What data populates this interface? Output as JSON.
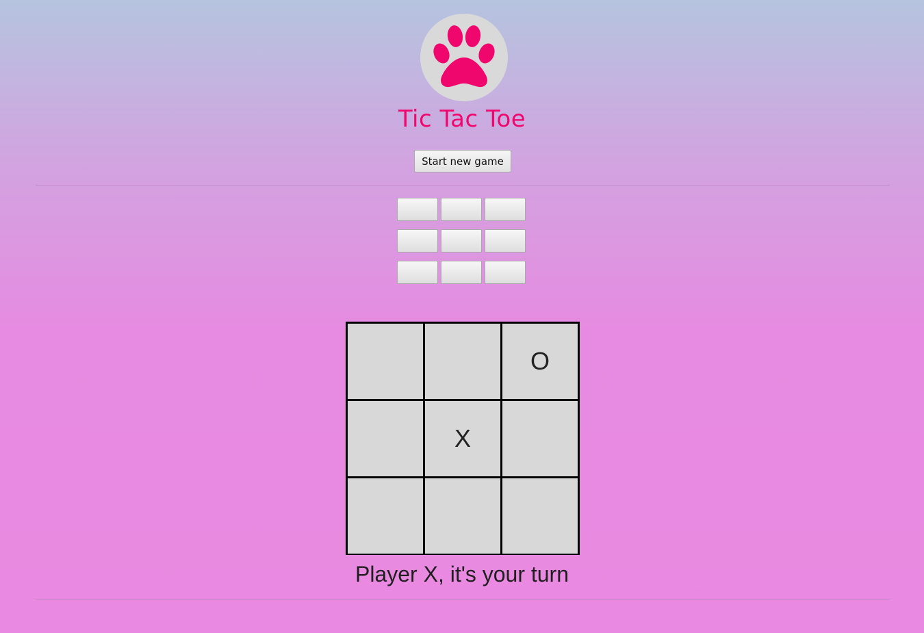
{
  "header": {
    "logo_icon": "paw-print-icon",
    "title": "Tic Tac Toe",
    "new_game_label": "Start new game"
  },
  "mini_buttons": [
    "",
    "",
    "",
    "",
    "",
    "",
    "",
    "",
    ""
  ],
  "board": {
    "cells": [
      "",
      "",
      "O",
      "",
      "X",
      "",
      "",
      "",
      ""
    ]
  },
  "status": "Player X, it's your turn",
  "colors": {
    "accent": "#f0076e",
    "logo_bg": "#d9d9d9",
    "cell_bg": "#d8d8d8",
    "grid_line": "#000000",
    "gradient_top": "#b5c4df",
    "gradient_bottom": "#ea89e1"
  }
}
